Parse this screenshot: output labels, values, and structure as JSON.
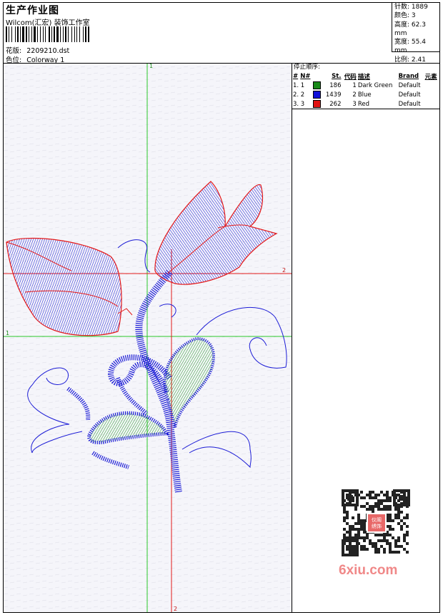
{
  "header": {
    "title": "生产作业图",
    "company": "Wilcom(汇宏) 装饰工作室",
    "design_label": "花版:",
    "design_value": "2209210.dst",
    "colorway_label": "色位:",
    "colorway_value": "Colorway 1"
  },
  "stats": {
    "stitches": "针数: 1889",
    "colors": "颜色: 3",
    "height": "高度: 62.3 mm",
    "width": "宽度: 55.4 mm",
    "scale": "比例: 2.41"
  },
  "stop_sequence": {
    "heading": "停止顺序:",
    "columns": [
      "#",
      "N#",
      "St.",
      "代码",
      "描述",
      "Brand",
      "元素"
    ],
    "rows": [
      {
        "num": "1. 1",
        "color": "#1a8a1a",
        "stitches": "186",
        "code": "1",
        "desc": "Dark Green",
        "brand": "Default"
      },
      {
        "num": "2. 2",
        "color": "#1010d8",
        "stitches": "1439",
        "code": "2",
        "desc": "Blue",
        "brand": "Default"
      },
      {
        "num": "3. 3",
        "color": "#e01010",
        "stitches": "262",
        "code": "3",
        "desc": "Red",
        "brand": "Default"
      }
    ]
  },
  "canvas": {
    "guide_v1": "1",
    "guide_h1": "1",
    "guide_v2": "2",
    "guide_h2": "2"
  },
  "watermark": {
    "text": "6xiu.com",
    "qr_badge": "仪阁绣饰"
  }
}
